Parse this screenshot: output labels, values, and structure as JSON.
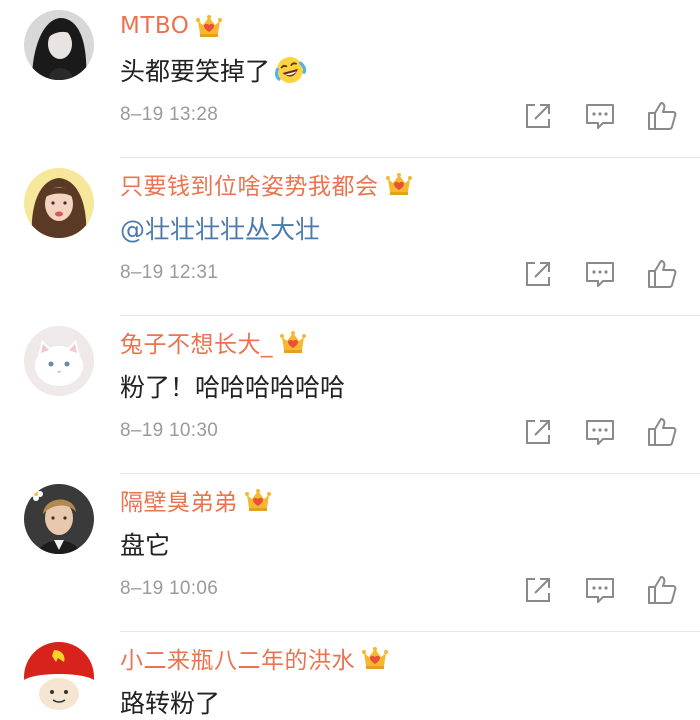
{
  "comments": [
    {
      "username": "MTBO",
      "text": "头都要笑掉了",
      "emoji": "laugh-cry-emoji",
      "time": "8–19 13:28",
      "avatar": "avatar-girl-dark"
    },
    {
      "username": "只要钱到位啥姿势我都会",
      "text": "@壮壮壮壮丛大壮",
      "time": "8–19 12:31",
      "avatar": "avatar-girl-yellow"
    },
    {
      "username": "兔子不想长大_",
      "text": "粉了！哈哈哈哈哈哈",
      "time": "8–19 10:30",
      "avatar": "avatar-white-cat"
    },
    {
      "username": "隔壁臭弟弟",
      "text": "盘它",
      "time": "8–19 10:06",
      "avatar": "avatar-young-man"
    },
    {
      "username": "小二来瓶八二年的洪水",
      "text": "路转粉了",
      "avatar": "avatar-red-meme"
    }
  ],
  "icons": {
    "vip": "vip-crown-icon",
    "share": "share-icon",
    "reply": "reply-icon",
    "like": "like-icon"
  },
  "colors": {
    "username": "#eb7350",
    "mention": "#4a7aab",
    "text": "#222222",
    "time": "#9a9a9a",
    "icon": "#8a8a8a",
    "vip_gold": "#f5b82e",
    "vip_red": "#e8503a"
  }
}
